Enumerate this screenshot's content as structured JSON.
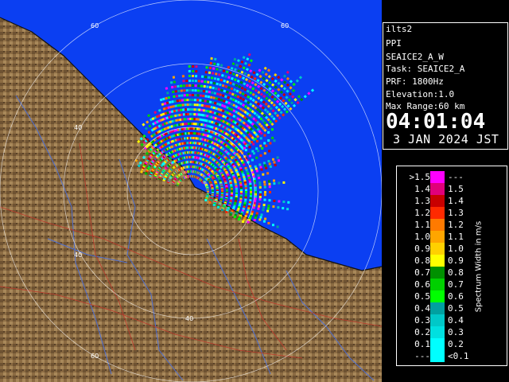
{
  "info": {
    "radar": "ilts2",
    "scan_type": "PPI",
    "scan_name": "SEAICE2_A_W",
    "task": "Task: SEAICE2_A",
    "prf": "PRF: 1800Hz",
    "elevation": "Elevation:1.0",
    "max_range": "Max Range:60 km",
    "time": "04:01:04",
    "date": "3 JAN 2024 JST"
  },
  "legend": {
    "title": "Spectrum Width in m/s",
    "rows": [
      {
        "lo": ">1.5",
        "hi": "---",
        "color": "#ff00ff"
      },
      {
        "lo": "1.4",
        "hi": "1.5",
        "color": "#e0007a"
      },
      {
        "lo": "1.3",
        "hi": "1.4",
        "color": "#c80000"
      },
      {
        "lo": "1.2",
        "hi": "1.3",
        "color": "#ff2a00"
      },
      {
        "lo": "1.1",
        "hi": "1.2",
        "color": "#ff7a00"
      },
      {
        "lo": "1.0",
        "hi": "1.1",
        "color": "#ffa500"
      },
      {
        "lo": "0.9",
        "hi": "1.0",
        "color": "#ffd000"
      },
      {
        "lo": "0.8",
        "hi": "0.9",
        "color": "#ffff00"
      },
      {
        "lo": "0.7",
        "hi": "0.8",
        "color": "#009000"
      },
      {
        "lo": "0.6",
        "hi": "0.7",
        "color": "#00d000"
      },
      {
        "lo": "0.5",
        "hi": "0.6",
        "color": "#00ff00"
      },
      {
        "lo": "0.4",
        "hi": "0.5",
        "color": "#00a0a0"
      },
      {
        "lo": "0.3",
        "hi": "0.4",
        "color": "#00c8c8"
      },
      {
        "lo": "0.2",
        "hi": "0.3",
        "color": "#00e0e0"
      },
      {
        "lo": "0.1",
        "hi": "0.2",
        "color": "#00ffff"
      },
      {
        "lo": "---",
        "hi": "<0.1",
        "color": "#00ffff"
      }
    ]
  },
  "map": {
    "range_ring_labels": [
      "60",
      "60",
      "40",
      "40",
      "40",
      "60"
    ],
    "colors": {
      "sea": "#0b3ff2",
      "land": "#8b6b42",
      "rings": "#ffffff",
      "roads": "#c0392b",
      "rivers": "#4f6fd0"
    }
  }
}
